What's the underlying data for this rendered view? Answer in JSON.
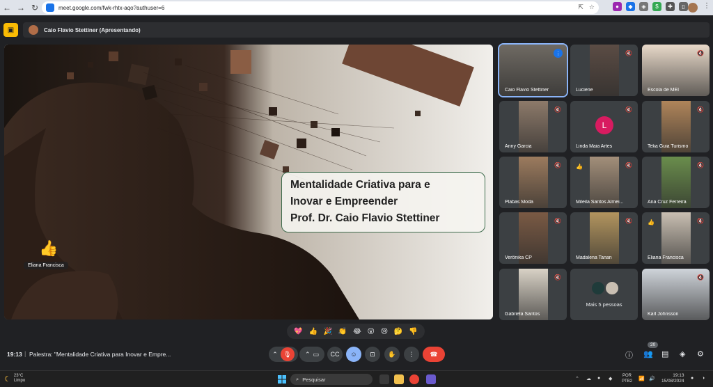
{
  "browser": {
    "url": "meet.google.com/fwk-rhtx-aqo?authuser=6"
  },
  "meet": {
    "presenter_label": "Caio Flavio Stettiner (Apresentando)",
    "slide_title_lines": [
      "Mentalidade Criativa para e",
      "Inovar e Empreender",
      "Prof. Dr. Caio Flavio Stettiner"
    ],
    "slide_reaction": {
      "emoji": "👍",
      "name": "Eliana Francisca"
    },
    "participants": [
      {
        "name": "Caio Flavio Stettiner",
        "speaking": true,
        "thumb": false,
        "avatar": "",
        "color": "#6f6a63"
      },
      {
        "name": "Luciene",
        "speaking": false,
        "thumb": false,
        "avatar": "",
        "color": "#5b4c44"
      },
      {
        "name": "Escola de MEI",
        "speaking": false,
        "thumb": false,
        "avatar": "",
        "color": "#e8d9c9"
      },
      {
        "name": "Anny Garcia",
        "speaking": false,
        "thumb": false,
        "avatar": "",
        "color": "#8d7a6a"
      },
      {
        "name": "Linda Maia Artes",
        "speaking": false,
        "thumb": false,
        "avatar": "L",
        "color": "#d81b60"
      },
      {
        "name": "Teka Guia Turismo",
        "speaking": false,
        "thumb": false,
        "avatar": "",
        "color": "#b0855a"
      },
      {
        "name": "Plabas Moda",
        "speaking": false,
        "thumb": false,
        "avatar": "",
        "color": "#9c7b5e"
      },
      {
        "name": "Mileila Santos Almei...",
        "speaking": false,
        "thumb": true,
        "avatar": "",
        "color": "#a38f7a"
      },
      {
        "name": "Ana Cruz Ferreira",
        "speaking": false,
        "thumb": false,
        "avatar": "",
        "color": "#6a8d4c"
      },
      {
        "name": "Verônika CP",
        "speaking": false,
        "thumb": false,
        "avatar": "",
        "color": "#7a5a44"
      },
      {
        "name": "Madalena Tanan",
        "speaking": false,
        "thumb": false,
        "avatar": "",
        "color": "#b3955f"
      },
      {
        "name": "Eliana Francisca",
        "speaking": false,
        "thumb": true,
        "avatar": "",
        "color": "#c9bfb2"
      },
      {
        "name": "Gabriela Santos",
        "speaking": false,
        "thumb": false,
        "avatar": "",
        "color": "#d9d2c6"
      },
      {
        "name": "Mais 5 pessoas",
        "speaking": false,
        "thumb": false,
        "avatar": "",
        "color": "#3c4043"
      },
      {
        "name": "Karl Johnsson",
        "speaking": false,
        "thumb": false,
        "avatar": "",
        "color": "#cfd4da"
      }
    ],
    "reactions": [
      "💖",
      "👍",
      "🎉",
      "👏",
      "😂",
      "😮",
      "😢",
      "🤔",
      "👎"
    ],
    "time": "19:13",
    "meeting_title": "Palestra: \"Mentalidade Criativa para Inovar e Empre...",
    "participant_count": "20"
  },
  "taskbar": {
    "weather_temp": "23°C",
    "weather_desc": "Limpo",
    "search_placeholder": "Pesquisar",
    "lang_line1": "POR",
    "lang_line2": "PTB2",
    "clock_time": "19:13",
    "clock_date": "15/08/2024"
  },
  "colors": {
    "meet_bg": "#202124",
    "accent_blue": "#8ab4f8",
    "end_call_red": "#ea4335",
    "present_yellow": "#fbbc04"
  }
}
